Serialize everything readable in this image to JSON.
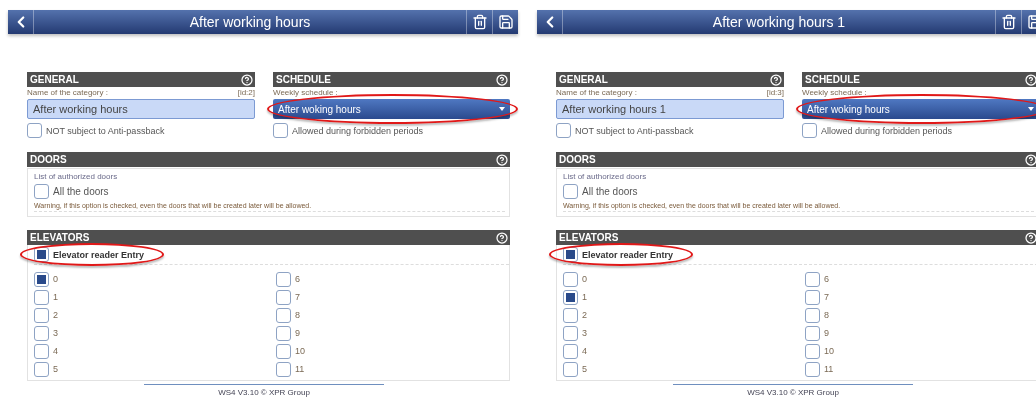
{
  "screens": [
    {
      "header": {
        "title": "After working hours"
      },
      "general": {
        "heading": "GENERAL",
        "name_label": "Name of the category :",
        "id_tag": "[id:2]",
        "name_value": "After working hours",
        "anti_passback": {
          "label": "NOT subject to Anti-passback",
          "checked": false
        }
      },
      "schedule": {
        "heading": "SCHEDULE",
        "weekly_label": "Weekly schedule :",
        "weekly_value": "After woking hours",
        "highlighted": true,
        "forbidden": {
          "label": "Allowed during forbidden periods",
          "checked": false
        }
      },
      "doors": {
        "heading": "DOORS",
        "legend": "List of authorized doors",
        "all_doors": {
          "label": "All the doors",
          "checked": false
        },
        "warning": "Warning, if this option is checked, even the doors that will be created later will be allowed."
      },
      "elevators": {
        "heading": "ELEVATORS",
        "reader": {
          "label": "Elevator reader Entry",
          "checked": true,
          "highlighted": true
        },
        "floors": [
          {
            "label": "0",
            "checked": true
          },
          {
            "label": "1",
            "checked": false
          },
          {
            "label": "2",
            "checked": false
          },
          {
            "label": "3",
            "checked": false
          },
          {
            "label": "4",
            "checked": false
          },
          {
            "label": "5",
            "checked": false
          },
          {
            "label": "6",
            "checked": false
          },
          {
            "label": "7",
            "checked": false
          },
          {
            "label": "8",
            "checked": false
          },
          {
            "label": "9",
            "checked": false
          },
          {
            "label": "10",
            "checked": false
          },
          {
            "label": "11",
            "checked": false
          }
        ]
      },
      "footer": "WS4 V3.10 © XPR Group"
    },
    {
      "header": {
        "title": "After working hours 1"
      },
      "general": {
        "heading": "GENERAL",
        "name_label": "Name of the category :",
        "id_tag": "[id:3]",
        "name_value": "After working hours 1",
        "anti_passback": {
          "label": "NOT subject to Anti-passback",
          "checked": false
        }
      },
      "schedule": {
        "heading": "SCHEDULE",
        "weekly_label": "Weekly schedule :",
        "weekly_value": "After woking hours",
        "highlighted": true,
        "forbidden": {
          "label": "Allowed during forbidden periods",
          "checked": false
        }
      },
      "doors": {
        "heading": "DOORS",
        "legend": "List of authorized doors",
        "all_doors": {
          "label": "All the doors",
          "checked": false
        },
        "warning": "Warning, if this option is checked, even the doors that will be created later will be allowed."
      },
      "elevators": {
        "heading": "ELEVATORS",
        "reader": {
          "label": "Elevator reader Entry",
          "checked": true,
          "highlighted": true
        },
        "floors": [
          {
            "label": "0",
            "checked": false
          },
          {
            "label": "1",
            "checked": true
          },
          {
            "label": "2",
            "checked": false
          },
          {
            "label": "3",
            "checked": false
          },
          {
            "label": "4",
            "checked": false
          },
          {
            "label": "5",
            "checked": false
          },
          {
            "label": "6",
            "checked": false
          },
          {
            "label": "7",
            "checked": false
          },
          {
            "label": "8",
            "checked": false
          },
          {
            "label": "9",
            "checked": false
          },
          {
            "label": "10",
            "checked": false
          },
          {
            "label": "11",
            "checked": false
          }
        ]
      },
      "footer": "WS4 V3.10 © XPR Group"
    }
  ]
}
